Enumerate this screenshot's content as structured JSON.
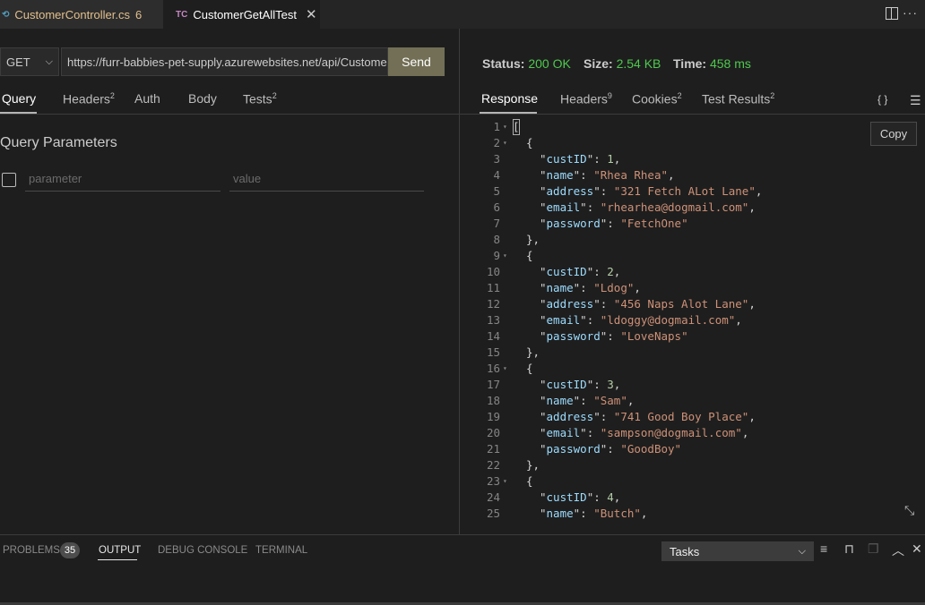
{
  "tabs": [
    {
      "icon": "C#",
      "label": "CustomerController.cs",
      "badge": "6"
    },
    {
      "icon": "TC",
      "label": "CustomerGetAllTest",
      "close": "✕"
    }
  ],
  "request": {
    "method": "GET",
    "url": "https://furr-babbies-pet-supply.azurewebsites.net/api/Customer",
    "send_label": "Send",
    "tabs": [
      {
        "label": "Query"
      },
      {
        "label": "Headers",
        "count": "2"
      },
      {
        "label": "Auth"
      },
      {
        "label": "Body"
      },
      {
        "label": "Tests",
        "count": "2"
      }
    ],
    "query_title": "Query Parameters",
    "param_placeholder": "parameter",
    "value_placeholder": "value"
  },
  "response": {
    "status_label": "Status:",
    "status_value": "200 OK",
    "size_label": "Size:",
    "size_value": "2.54 KB",
    "time_label": "Time:",
    "time_value": "458 ms",
    "tabs": [
      {
        "label": "Response"
      },
      {
        "label": "Headers",
        "count": "9"
      },
      {
        "label": "Cookies",
        "count": "2"
      },
      {
        "label": "Test Results",
        "count": "2"
      }
    ],
    "braces": "{ }",
    "copy_label": "Copy",
    "colors": {
      "status_ok": "#4ec94e",
      "key": "#9cdcfe",
      "string": "#ce9178",
      "number": "#b5cea8"
    },
    "code_lines": [
      {
        "n": "1",
        "fold": true,
        "indent": 0,
        "text": "["
      },
      {
        "n": "2",
        "fold": true,
        "indent": 1,
        "text": "{"
      },
      {
        "n": "3",
        "indent": 2,
        "key": "custID",
        "num": "1"
      },
      {
        "n": "4",
        "indent": 2,
        "key": "name",
        "str": "Rhea Rhea"
      },
      {
        "n": "5",
        "indent": 2,
        "key": "address",
        "str": "321 Fetch ALot Lane"
      },
      {
        "n": "6",
        "indent": 2,
        "key": "email",
        "str": "rhearhea@dogmail.com"
      },
      {
        "n": "7",
        "indent": 2,
        "key": "password",
        "str": "FetchOne",
        "last": true
      },
      {
        "n": "8",
        "indent": 1,
        "text": "},"
      },
      {
        "n": "9",
        "fold": true,
        "indent": 1,
        "text": "{"
      },
      {
        "n": "10",
        "indent": 2,
        "key": "custID",
        "num": "2"
      },
      {
        "n": "11",
        "indent": 2,
        "key": "name",
        "str": "Ldog"
      },
      {
        "n": "12",
        "indent": 2,
        "key": "address",
        "str": "456 Naps Alot Lane"
      },
      {
        "n": "13",
        "indent": 2,
        "key": "email",
        "str": "ldoggy@dogmail.com"
      },
      {
        "n": "14",
        "indent": 2,
        "key": "password",
        "str": "LoveNaps",
        "last": true
      },
      {
        "n": "15",
        "indent": 1,
        "text": "},"
      },
      {
        "n": "16",
        "fold": true,
        "indent": 1,
        "text": "{"
      },
      {
        "n": "17",
        "indent": 2,
        "key": "custID",
        "num": "3"
      },
      {
        "n": "18",
        "indent": 2,
        "key": "name",
        "str": "Sam"
      },
      {
        "n": "19",
        "indent": 2,
        "key": "address",
        "str": "741 Good Boy Place"
      },
      {
        "n": "20",
        "indent": 2,
        "key": "email",
        "str": "sampson@dogmail.com"
      },
      {
        "n": "21",
        "indent": 2,
        "key": "password",
        "str": "GoodBoy",
        "last": true
      },
      {
        "n": "22",
        "indent": 1,
        "text": "},"
      },
      {
        "n": "23",
        "fold": true,
        "indent": 1,
        "text": "{"
      },
      {
        "n": "24",
        "indent": 2,
        "key": "custID",
        "num": "4"
      },
      {
        "n": "25",
        "indent": 2,
        "key": "name",
        "str": "Butch"
      }
    ]
  },
  "panel": {
    "tabs": [
      "PROBLEMS",
      "OUTPUT",
      "DEBUG CONSOLE",
      "TERMINAL"
    ],
    "problems_count": "35",
    "task_select": "Tasks"
  }
}
